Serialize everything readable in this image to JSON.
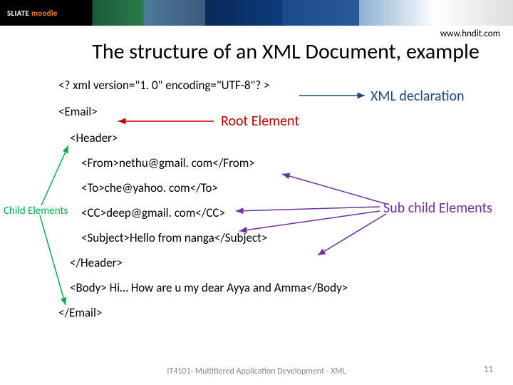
{
  "header": {
    "logo": "SLIATE moodle",
    "url": "www.hndit.com"
  },
  "title": "The structure of an XML Document, example",
  "code": {
    "decl": "<? xml version=\"1. 0\" encoding=\"UTF-8\"? >",
    "email_open": "<Email>",
    "header_open": "<Header>",
    "from": "<From>nethu@gmail. com</From>",
    "to": "<To>che@yahoo. com</To>",
    "cc": "<CC>deep@gmail. com</CC>",
    "subject": "<Subject>Hello from nanga</Subject>",
    "header_close": "</Header>",
    "body": "<Body> Hi… How are u  my dear Ayya and Amma</Body>",
    "email_close": "</Email>"
  },
  "annotations": {
    "xml_decl": "XML declaration",
    "root": "Root Element",
    "child": "Child Elements",
    "sub": "Sub child Elements"
  },
  "footer": {
    "course": "IT4101- Multitiered Application Development - XML",
    "page": "11"
  }
}
